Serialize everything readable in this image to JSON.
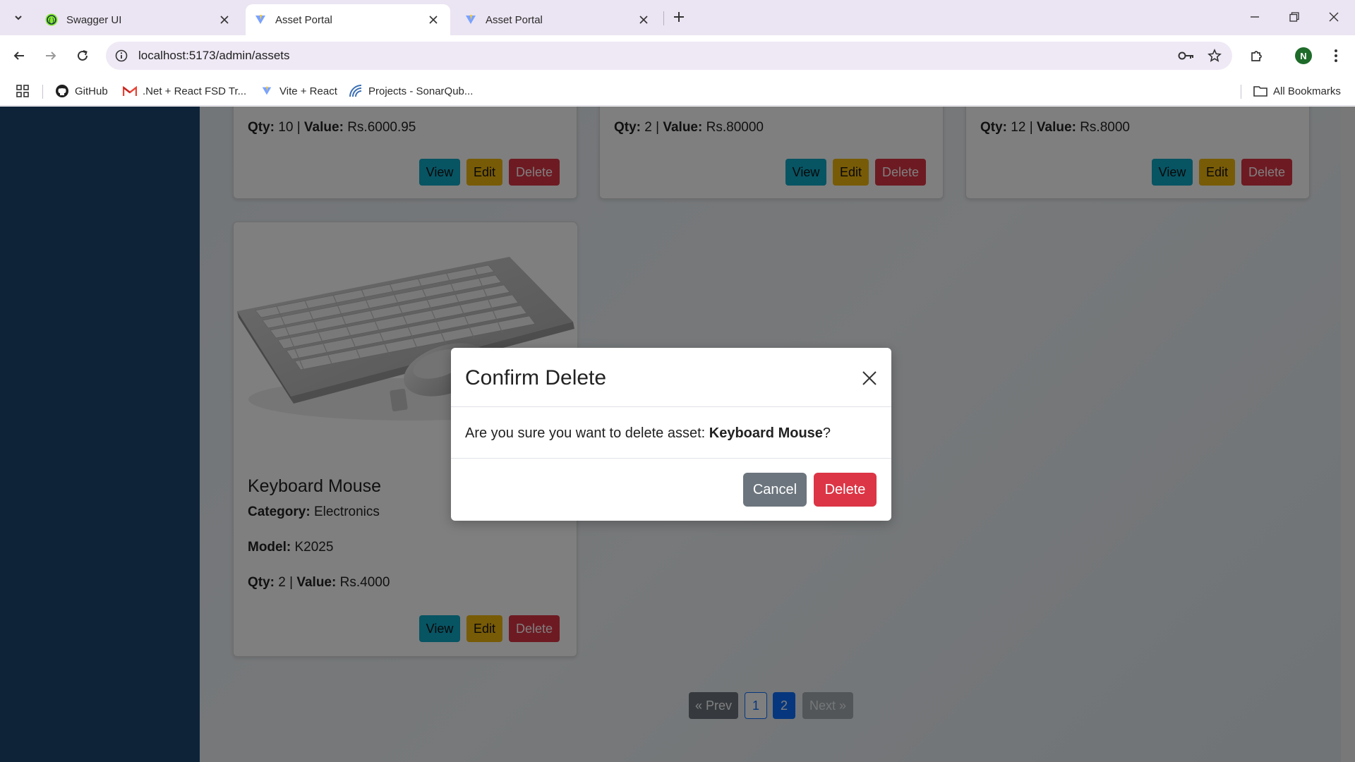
{
  "browser": {
    "tabs": [
      {
        "title": "Swagger UI",
        "active": false
      },
      {
        "title": "Asset Portal",
        "active": true
      },
      {
        "title": "Asset Portal",
        "active": false
      }
    ],
    "url": "localhost:5173/admin/assets",
    "profile_initial": "N",
    "bookmarks": [
      "GitHub",
      ".Net + React FSD Tr...",
      "Vite + React",
      "Projects - SonarQub..."
    ],
    "all_bookmarks_label": "All Bookmarks"
  },
  "assets": {
    "top_cards": [
      {
        "qty_label": "Qty:",
        "qty": "10",
        "sep": "|",
        "value_label": "Value:",
        "value": "Rs.6000.95"
      },
      {
        "qty_label": "Qty:",
        "qty": "2",
        "sep": "|",
        "value_label": "Value:",
        "value": "Rs.80000"
      },
      {
        "qty_label": "Qty:",
        "qty": "12",
        "sep": "|",
        "value_label": "Value:",
        "value": "Rs.8000"
      }
    ],
    "card4": {
      "name": "Keyboard Mouse",
      "category_label": "Category:",
      "category": "Electronics",
      "model_label": "Model:",
      "model": "K2025",
      "qty_label": "Qty:",
      "qty": "2",
      "sep": "|",
      "value_label": "Value:",
      "value": "Rs.4000"
    },
    "buttons": {
      "view": "View",
      "edit": "Edit",
      "delete": "Delete"
    }
  },
  "pagination": {
    "prev": "« Prev",
    "pages": [
      "1",
      "2"
    ],
    "current": "2",
    "next": "Next »"
  },
  "modal": {
    "title": "Confirm Delete",
    "message": "Are you sure you want to delete asset:",
    "asset_name": "Keyboard Mouse",
    "suffix": "?",
    "cancel": "Cancel",
    "delete": "Delete"
  },
  "colors": {
    "sidebar": "#1d4670",
    "view": "#0fa9c6",
    "edit": "#f1b60d",
    "delete": "#dc3545",
    "cancel": "#6c757d",
    "page_active": "#0d6efd"
  }
}
